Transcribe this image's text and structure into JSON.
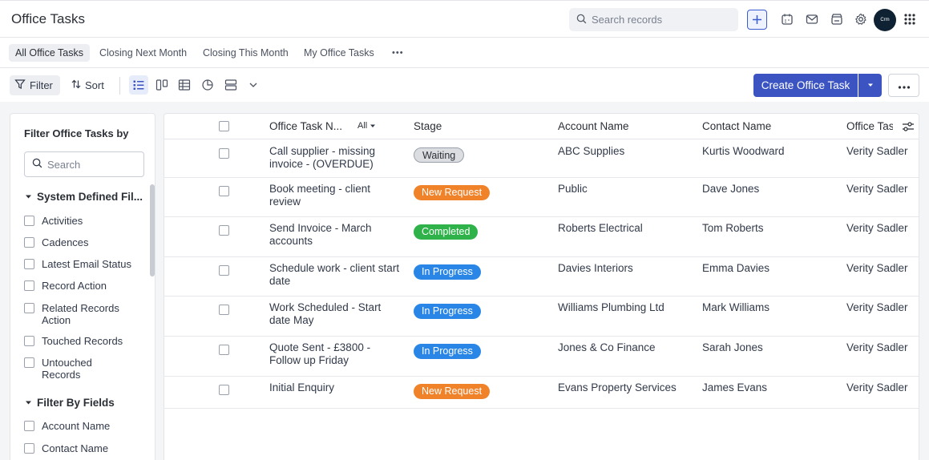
{
  "header": {
    "title": "Office Tasks",
    "search_placeholder": "Search records",
    "avatar_text": "Crm"
  },
  "views": {
    "tabs": [
      {
        "label": "All Office Tasks",
        "active": true
      },
      {
        "label": "Closing Next Month"
      },
      {
        "label": "Closing This Month"
      },
      {
        "label": "My Office Tasks"
      }
    ],
    "more": "•••"
  },
  "toolbar": {
    "filter_label": "Filter",
    "sort_label": "Sort",
    "create_label": "Create Office Task"
  },
  "sidebar": {
    "title": "Filter Office Tasks by",
    "search_placeholder": "Search",
    "section_system": "System Defined Fil...",
    "system_items": [
      "Activities",
      "Cadences",
      "Latest Email Status",
      "Record Action",
      "Related Records Action",
      "Touched Records",
      "Untouched Records"
    ],
    "section_fields": "Filter By Fields",
    "field_items": [
      "Account Name",
      "Contact Name"
    ]
  },
  "table": {
    "columns": {
      "name": "Office Task N...",
      "name_filter": "All",
      "stage": "Stage",
      "account": "Account Name",
      "contact": "Contact Name",
      "owner": "Office Tas"
    },
    "rows": [
      {
        "name": "Call supplier - missing invoice - (OVERDUE)",
        "stage": "Waiting",
        "account": "ABC Supplies",
        "contact": "Kurtis Woodward",
        "owner": "Verity Sadler"
      },
      {
        "name": "Book meeting - client review",
        "stage": "New Request",
        "account": "Public",
        "contact": "Dave Jones",
        "owner": "Verity Sadler"
      },
      {
        "name": "Send Invoice - March accounts",
        "stage": "Completed",
        "account": "Roberts Electrical",
        "contact": "Tom Roberts",
        "owner": "Verity Sadler"
      },
      {
        "name": "Schedule work - client start date",
        "stage": "In Progress",
        "account": "Davies Interiors",
        "contact": "Emma Davies",
        "owner": "Verity Sadler"
      },
      {
        "name": "Work Scheduled - Start date May",
        "stage": "In Progress",
        "account": "Williams Plumbing Ltd",
        "contact": "Mark Williams",
        "owner": "Verity Sadler"
      },
      {
        "name": "Quote Sent - £3800 - Follow up Friday",
        "stage": "In Progress",
        "account": "Jones & Co Finance",
        "contact": "Sarah Jones",
        "owner": "Verity Sadler"
      },
      {
        "name": "Initial Enquiry",
        "stage": "New Request",
        "account": "Evans Property Services",
        "contact": "James Evans",
        "owner": "Verity Sadler"
      }
    ]
  },
  "colors": {
    "accent": "#3b54c2",
    "stage_waiting": "#dcdde1",
    "stage_new_request": "#f0822a",
    "stage_completed": "#2fb24a",
    "stage_in_progress": "#2a86e6"
  }
}
